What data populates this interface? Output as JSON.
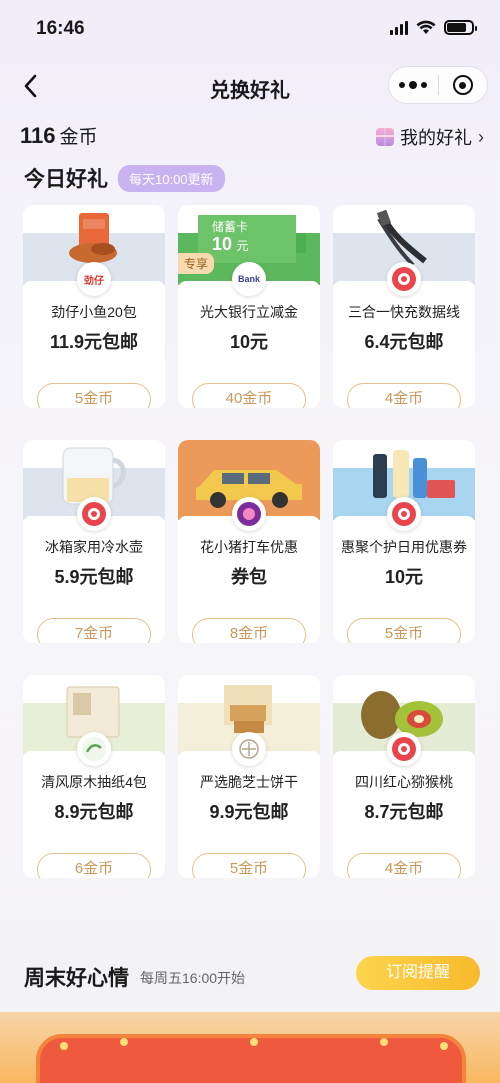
{
  "status_bar": {
    "time": "16:46"
  },
  "nav": {
    "title": "兑换好礼"
  },
  "coins": {
    "amount": "116",
    "unit": "金币"
  },
  "my_gifts": {
    "label": "我的好礼",
    "chevron": "›"
  },
  "today": {
    "title": "今日好礼",
    "badge": "每天10:00更新"
  },
  "gifts": [
    {
      "name": "劲仔小鱼20包",
      "price": "11.9元包邮",
      "button": "5金币",
      "brand": "劲仔"
    },
    {
      "name": "光大银行立减金",
      "price": "10元",
      "button": "40金币",
      "tag": "专享",
      "card_label": "储蓄卡",
      "card_amount": "10",
      "card_unit": "元",
      "badge_text": "Bank"
    },
    {
      "name": "三合一快充数据线",
      "price": "6.4元包邮",
      "button": "4金币"
    },
    {
      "name": "冰箱家用冷水壶",
      "price": "5.9元包邮",
      "button": "7金币"
    },
    {
      "name": "花小猪打车优惠",
      "price": "券包",
      "button": "8金币"
    },
    {
      "name": "惠聚个护日用优惠券",
      "price": "10元",
      "button": "5金币"
    },
    {
      "name": "清风原木抽纸4包",
      "price": "8.9元包邮",
      "button": "6金币"
    },
    {
      "name": "严选脆芝士饼干",
      "price": "9.9元包邮",
      "button": "5金币"
    },
    {
      "name": "四川红心猕猴桃",
      "price": "8.7元包邮",
      "button": "4金币"
    }
  ],
  "weekend": {
    "title": "周末好心情",
    "subtitle": "每周五16:00开始",
    "button": "订阅提醒"
  },
  "colors": {
    "accent": "#c8b2ef",
    "button_border": "#e2c28c",
    "button_text": "#c9985a",
    "subscribe": "#f8ba2c"
  },
  "icons": [
    "back-icon",
    "more-icon",
    "close-capsule-icon",
    "gift-box-icon",
    "chevron-right-icon",
    "signal-icon",
    "wifi-icon",
    "battery-icon"
  ]
}
